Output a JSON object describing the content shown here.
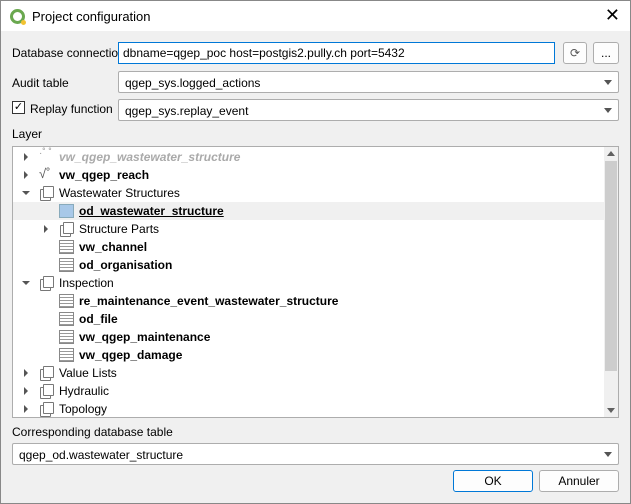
{
  "window": {
    "title": "Project configuration"
  },
  "form": {
    "db_label": "Database connection",
    "db_value": "dbname=qgep_poc host=postgis2.pully.ch port=5432",
    "browse_label": "...",
    "audit_label": "Audit table",
    "audit_value": "qgep_sys.logged_actions",
    "replay_label": "Replay function",
    "replay_checked": true,
    "replay_value": "qgep_sys.replay_event",
    "layer_label": "Layer",
    "corr_label": "Corresponding database table",
    "corr_value": "qgep_od.wastewater_structure"
  },
  "tree": [
    {
      "label": "vw_qgep_wastewater_structure",
      "level": 0,
      "icon": "point-layer-icon",
      "expander": "collapsed",
      "style": "disabled"
    },
    {
      "label": "vw_qgep_reach",
      "level": 0,
      "icon": "line-layer-icon",
      "expander": "collapsed",
      "style": "bold"
    },
    {
      "label": "Wastewater Structures",
      "level": 0,
      "icon": "group-icon",
      "expander": "expanded",
      "style": "normal"
    },
    {
      "label": "od_wastewater_structure",
      "level": 1,
      "icon": "polygon-layer-icon",
      "expander": "none",
      "style": "selected"
    },
    {
      "label": "Structure Parts",
      "level": 1,
      "icon": "group-icon",
      "expander": "collapsed",
      "style": "normal"
    },
    {
      "label": "vw_channel",
      "level": 1,
      "icon": "table-icon",
      "expander": "none",
      "style": "bold"
    },
    {
      "label": "od_organisation",
      "level": 1,
      "icon": "table-icon",
      "expander": "none",
      "style": "bold"
    },
    {
      "label": "Inspection",
      "level": 0,
      "icon": "group-icon",
      "expander": "expanded",
      "style": "normal"
    },
    {
      "label": "re_maintenance_event_wastewater_structure",
      "level": 1,
      "icon": "table-icon",
      "expander": "none",
      "style": "bold"
    },
    {
      "label": "od_file",
      "level": 1,
      "icon": "table-icon",
      "expander": "none",
      "style": "bold"
    },
    {
      "label": "vw_qgep_maintenance",
      "level": 1,
      "icon": "table-icon",
      "expander": "none",
      "style": "bold"
    },
    {
      "label": "vw_qgep_damage",
      "level": 1,
      "icon": "table-icon",
      "expander": "none",
      "style": "bold"
    },
    {
      "label": "Value Lists",
      "level": 0,
      "icon": "group-icon",
      "expander": "collapsed",
      "style": "normal"
    },
    {
      "label": "Hydraulic",
      "level": 0,
      "icon": "group-icon",
      "expander": "collapsed",
      "style": "normal"
    },
    {
      "label": "Topology",
      "level": 0,
      "icon": "group-icon",
      "expander": "collapsed",
      "style": "normal"
    }
  ],
  "buttons": {
    "ok": "OK",
    "cancel": "Annuler"
  }
}
